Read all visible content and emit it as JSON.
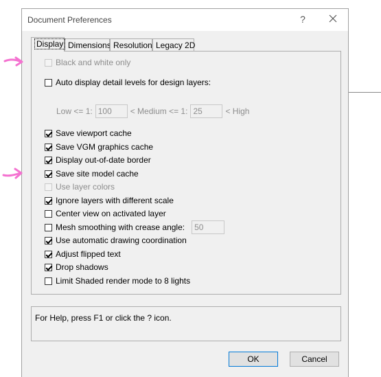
{
  "window": {
    "title": "Document Preferences",
    "help_label": "?"
  },
  "tabs": [
    {
      "label": "Display",
      "active": true
    },
    {
      "label": "Dimensions",
      "active": false
    },
    {
      "label": "Resolution",
      "active": false
    },
    {
      "label": "Legacy 2D",
      "active": false
    }
  ],
  "options": {
    "black_white": {
      "label": "Black and white only",
      "checked": false,
      "enabled": false
    },
    "auto_detail": {
      "label": "Auto display detail levels for design layers:",
      "checked": false,
      "enabled": true
    },
    "save_viewport_cache": {
      "label": "Save viewport cache",
      "checked": true,
      "enabled": true
    },
    "save_vgm_cache": {
      "label": "Save VGM graphics cache",
      "checked": true,
      "enabled": true
    },
    "out_of_date_border": {
      "label": "Display out-of-date border",
      "checked": true,
      "enabled": true
    },
    "save_site_model_cache": {
      "label": "Save site model cache",
      "checked": true,
      "enabled": true
    },
    "use_layer_colors": {
      "label": "Use layer colors",
      "checked": false,
      "enabled": false
    },
    "ignore_layers_scale": {
      "label": "Ignore layers with different scale",
      "checked": true,
      "enabled": true
    },
    "center_view": {
      "label": "Center view on activated layer",
      "checked": false,
      "enabled": true
    },
    "mesh_smoothing": {
      "label": "Mesh smoothing with crease angle:",
      "checked": false,
      "enabled": true
    },
    "auto_drawing_coord": {
      "label": "Use automatic drawing coordination",
      "checked": true,
      "enabled": true
    },
    "adjust_flipped_text": {
      "label": "Adjust flipped text",
      "checked": true,
      "enabled": true
    },
    "drop_shadows": {
      "label": "Drop shadows",
      "checked": true,
      "enabled": true
    },
    "limit_shaded": {
      "label": "Limit Shaded render mode to 8 lights",
      "checked": false,
      "enabled": true
    }
  },
  "detail_levels": {
    "low_label": "Low <= 1:",
    "low_value": "100",
    "medium_label": "< Medium <= 1:",
    "medium_value": "25",
    "high_label": "< High"
  },
  "mesh_angle_value": "50",
  "help_text": "For Help, press F1 or click the ? icon.",
  "buttons": {
    "ok": "OK",
    "cancel": "Cancel"
  },
  "colors": {
    "annotation": "#f472d0",
    "accent": "#0078d7"
  }
}
